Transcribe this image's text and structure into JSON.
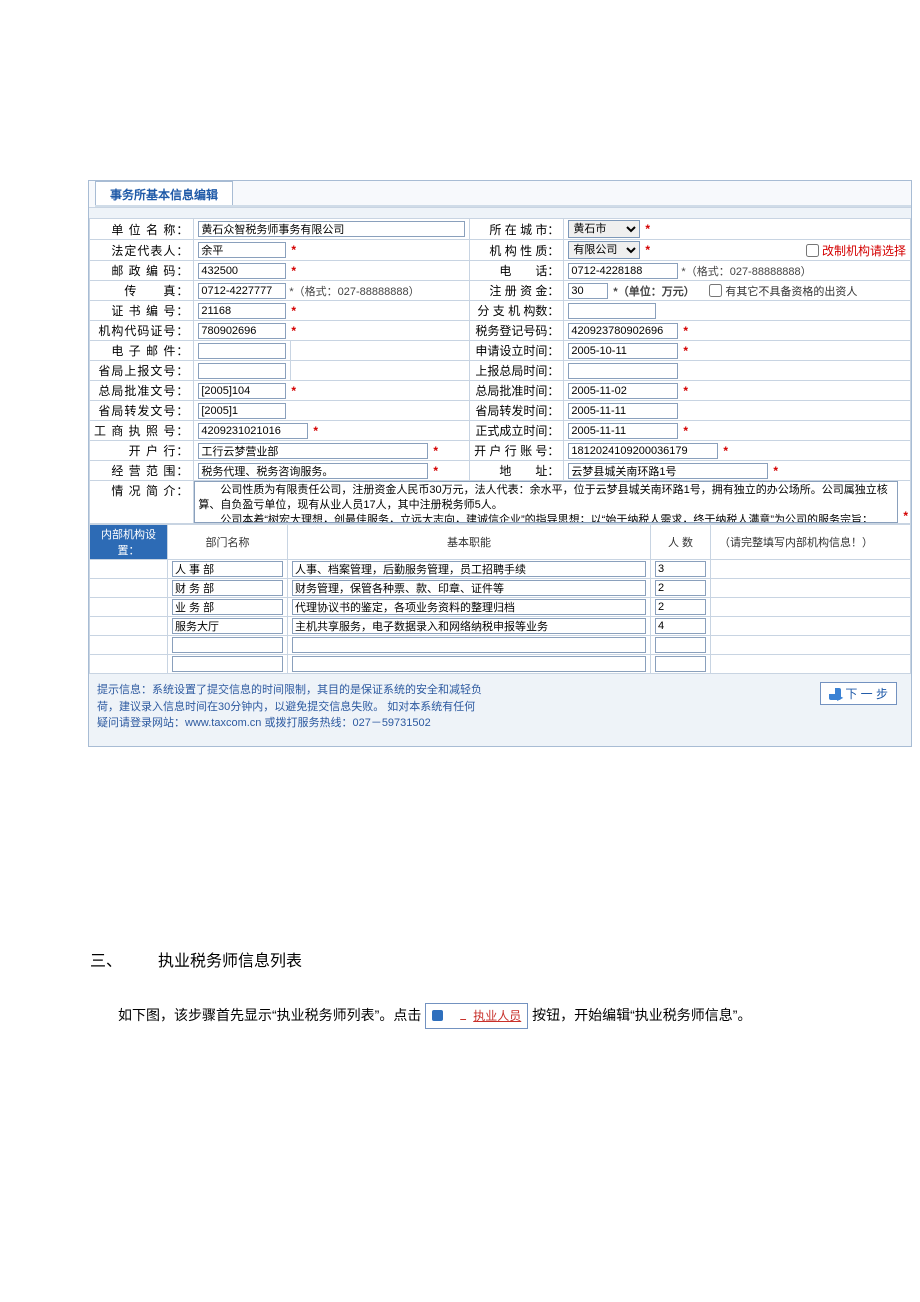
{
  "tab_title": "事务所基本信息编辑",
  "labels": {
    "unit_name": "单 位 名 称：",
    "city": "所 在 城 市：",
    "legal_rep": "法定代表人：",
    "org_nature": "机 构 性 质：",
    "postal": "邮 政 编 码：",
    "phone": "电　　话：",
    "fax": "传　　真：",
    "reg_capital": "注 册 资 金：",
    "cert_no": "证 书 编 号：",
    "branch_cnt": "分 支 机 构数：",
    "org_code": "机构代码证号：",
    "tax_reg": "税务登记号码：",
    "email": "电 子 邮 件：",
    "apply_time": "申请设立时间：",
    "prov_report": "省局上报文号：",
    "report_time": "上报总局时间：",
    "bureau_doc": "总局批准文号：",
    "bureau_time": "总局批准时间：",
    "prov_forward": "省局转发文号：",
    "prov_forward_time": "省局转发时间：",
    "biz_license": "工 商 执 照 号：",
    "official_time": "正式成立时间：",
    "bank": "开 户 行：",
    "bank_acct": "开 户 行 账 号：",
    "scope": "经 营 范 围：",
    "address": "地　　址：",
    "intro": "情 况 简 介：",
    "dept_setup": "内部机构设置："
  },
  "values": {
    "unit_name": "黄石众智税务师事务有限公司",
    "city": "黄石市",
    "legal_rep": "余平",
    "org_nature": "有限公司",
    "postal": "432500",
    "phone": "0712-4228188",
    "fax": "0712-4227777",
    "reg_capital": "30",
    "cert_no": "21168",
    "branch_cnt": "",
    "org_code": "780902696",
    "tax_reg": "420923780902696",
    "email": "",
    "apply_time": "2005-10-11",
    "prov_report": "",
    "report_time": "",
    "bureau_doc": "[2005]104",
    "bureau_time": "2005-11-02",
    "prov_forward": "[2005]1",
    "prov_forward_time": "2005-11-11",
    "biz_license": "4209231021016",
    "official_time": "2005-11-11",
    "bank": "工行云梦营业部",
    "bank_acct": "1812024109200036179",
    "scope": "税务代理、税务咨询服务。",
    "address": "云梦县城关南环路1号",
    "intro": "　　公司性质为有限责任公司，注册资金人民币30万元，法人代表：余水平，位于云梦县城关南环路1号，拥有独立的办公场所。公司属独立核算、自负盈亏单位，现有从业人员17人，其中注册税务师5人。\n　　公司本着“树宏大理想，创最佳服务，立远大志向，建诚信企业”的指导思想；以“始于纳税人需求，终于纳税人满意”为公司的服务宗旨；以“一切为了纳税人，一切服务纳税人，一切方便纳税人，一切维权纳税人”为公司的服务理念。真正构建税务机关与纳税人之间的互通平台。"
  },
  "hints": {
    "fax_fmt": "*（格式：027-88888888）",
    "phone_fmt": "*（格式：027-88888888）",
    "cap_unit": "*（单位：万元）",
    "change_org": "改制机构请选择",
    "qualify": "有其它不具备资格的出资人",
    "dept_fill": "（请完整填写内部机构信息！）"
  },
  "dept_head": {
    "name": "部门名称",
    "func": "基本职能",
    "count": "人 数"
  },
  "departments": [
    {
      "name": "人 事 部",
      "func": "人事、档案管理，后勤服务管理，员工招聘手续",
      "count": "3"
    },
    {
      "name": "财 务 部",
      "func": "财务管理，保管各种票、款、印章、证件等",
      "count": "2"
    },
    {
      "name": "业 务 部",
      "func": "代理协议书的鉴定，各项业务资料的整理归档",
      "count": "2"
    },
    {
      "name": "服务大厅",
      "func": "主机共享服务，电子数据录入和网络纳税申报等业务",
      "count": "4"
    },
    {
      "name": "",
      "func": "",
      "count": ""
    },
    {
      "name": "",
      "func": "",
      "count": ""
    }
  ],
  "footer_notes": [
    "提示信息：系统设置了提交信息的时间限制，其目的是保证系统的安全和减轻负",
    "荷，建议录入信息时间在30分钟内，以避免提交信息失败。  如对本系统有任何",
    "疑问请登录网站：www.taxcom.cn   或拨打服务热线：027－59731502"
  ],
  "next_btn": "下 一 步",
  "doc": {
    "heading_num": "三、",
    "heading": "执业税务师信息列表",
    "para_a": "如下图，该步骤首先显示“执业税务师列表”。点击",
    "btn": "执业人员",
    "para_b": "按钮，开始编辑“执业税务师信息”。"
  }
}
